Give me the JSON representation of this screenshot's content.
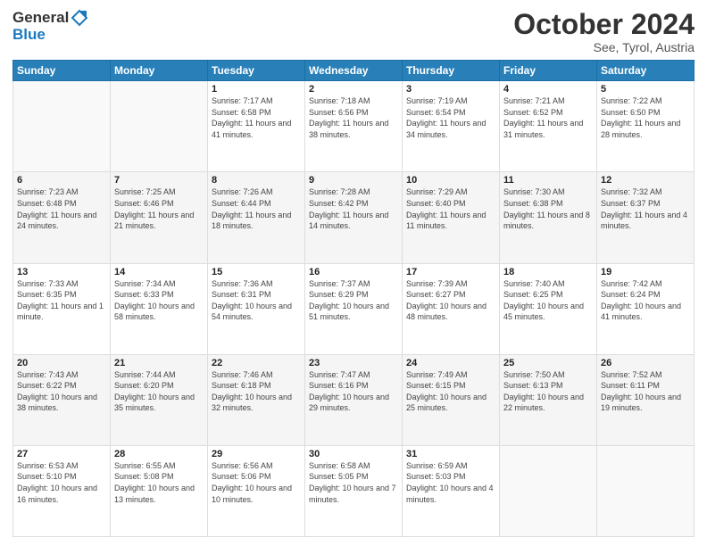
{
  "header": {
    "logo_line1": "General",
    "logo_line2": "Blue",
    "month": "October 2024",
    "location": "See, Tyrol, Austria"
  },
  "days_of_week": [
    "Sunday",
    "Monday",
    "Tuesday",
    "Wednesday",
    "Thursday",
    "Friday",
    "Saturday"
  ],
  "weeks": [
    [
      {
        "day": "",
        "info": ""
      },
      {
        "day": "",
        "info": ""
      },
      {
        "day": "1",
        "info": "Sunrise: 7:17 AM\nSunset: 6:58 PM\nDaylight: 11 hours and 41 minutes."
      },
      {
        "day": "2",
        "info": "Sunrise: 7:18 AM\nSunset: 6:56 PM\nDaylight: 11 hours and 38 minutes."
      },
      {
        "day": "3",
        "info": "Sunrise: 7:19 AM\nSunset: 6:54 PM\nDaylight: 11 hours and 34 minutes."
      },
      {
        "day": "4",
        "info": "Sunrise: 7:21 AM\nSunset: 6:52 PM\nDaylight: 11 hours and 31 minutes."
      },
      {
        "day": "5",
        "info": "Sunrise: 7:22 AM\nSunset: 6:50 PM\nDaylight: 11 hours and 28 minutes."
      }
    ],
    [
      {
        "day": "6",
        "info": "Sunrise: 7:23 AM\nSunset: 6:48 PM\nDaylight: 11 hours and 24 minutes."
      },
      {
        "day": "7",
        "info": "Sunrise: 7:25 AM\nSunset: 6:46 PM\nDaylight: 11 hours and 21 minutes."
      },
      {
        "day": "8",
        "info": "Sunrise: 7:26 AM\nSunset: 6:44 PM\nDaylight: 11 hours and 18 minutes."
      },
      {
        "day": "9",
        "info": "Sunrise: 7:28 AM\nSunset: 6:42 PM\nDaylight: 11 hours and 14 minutes."
      },
      {
        "day": "10",
        "info": "Sunrise: 7:29 AM\nSunset: 6:40 PM\nDaylight: 11 hours and 11 minutes."
      },
      {
        "day": "11",
        "info": "Sunrise: 7:30 AM\nSunset: 6:38 PM\nDaylight: 11 hours and 8 minutes."
      },
      {
        "day": "12",
        "info": "Sunrise: 7:32 AM\nSunset: 6:37 PM\nDaylight: 11 hours and 4 minutes."
      }
    ],
    [
      {
        "day": "13",
        "info": "Sunrise: 7:33 AM\nSunset: 6:35 PM\nDaylight: 11 hours and 1 minute."
      },
      {
        "day": "14",
        "info": "Sunrise: 7:34 AM\nSunset: 6:33 PM\nDaylight: 10 hours and 58 minutes."
      },
      {
        "day": "15",
        "info": "Sunrise: 7:36 AM\nSunset: 6:31 PM\nDaylight: 10 hours and 54 minutes."
      },
      {
        "day": "16",
        "info": "Sunrise: 7:37 AM\nSunset: 6:29 PM\nDaylight: 10 hours and 51 minutes."
      },
      {
        "day": "17",
        "info": "Sunrise: 7:39 AM\nSunset: 6:27 PM\nDaylight: 10 hours and 48 minutes."
      },
      {
        "day": "18",
        "info": "Sunrise: 7:40 AM\nSunset: 6:25 PM\nDaylight: 10 hours and 45 minutes."
      },
      {
        "day": "19",
        "info": "Sunrise: 7:42 AM\nSunset: 6:24 PM\nDaylight: 10 hours and 41 minutes."
      }
    ],
    [
      {
        "day": "20",
        "info": "Sunrise: 7:43 AM\nSunset: 6:22 PM\nDaylight: 10 hours and 38 minutes."
      },
      {
        "day": "21",
        "info": "Sunrise: 7:44 AM\nSunset: 6:20 PM\nDaylight: 10 hours and 35 minutes."
      },
      {
        "day": "22",
        "info": "Sunrise: 7:46 AM\nSunset: 6:18 PM\nDaylight: 10 hours and 32 minutes."
      },
      {
        "day": "23",
        "info": "Sunrise: 7:47 AM\nSunset: 6:16 PM\nDaylight: 10 hours and 29 minutes."
      },
      {
        "day": "24",
        "info": "Sunrise: 7:49 AM\nSunset: 6:15 PM\nDaylight: 10 hours and 25 minutes."
      },
      {
        "day": "25",
        "info": "Sunrise: 7:50 AM\nSunset: 6:13 PM\nDaylight: 10 hours and 22 minutes."
      },
      {
        "day": "26",
        "info": "Sunrise: 7:52 AM\nSunset: 6:11 PM\nDaylight: 10 hours and 19 minutes."
      }
    ],
    [
      {
        "day": "27",
        "info": "Sunrise: 6:53 AM\nSunset: 5:10 PM\nDaylight: 10 hours and 16 minutes."
      },
      {
        "day": "28",
        "info": "Sunrise: 6:55 AM\nSunset: 5:08 PM\nDaylight: 10 hours and 13 minutes."
      },
      {
        "day": "29",
        "info": "Sunrise: 6:56 AM\nSunset: 5:06 PM\nDaylight: 10 hours and 10 minutes."
      },
      {
        "day": "30",
        "info": "Sunrise: 6:58 AM\nSunset: 5:05 PM\nDaylight: 10 hours and 7 minutes."
      },
      {
        "day": "31",
        "info": "Sunrise: 6:59 AM\nSunset: 5:03 PM\nDaylight: 10 hours and 4 minutes."
      },
      {
        "day": "",
        "info": ""
      },
      {
        "day": "",
        "info": ""
      }
    ]
  ]
}
